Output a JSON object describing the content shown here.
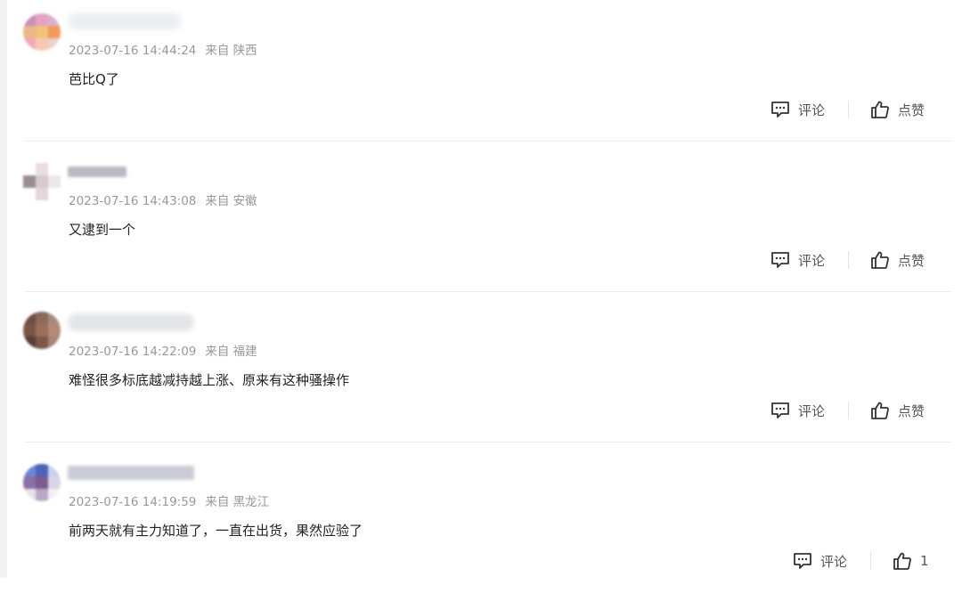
{
  "comments": [
    {
      "timestamp": "2023-07-16 14:44:24",
      "location": "来自 陕西",
      "content": "芭比Q了",
      "reply_label": "评论",
      "like_label": "点赞"
    },
    {
      "timestamp": "2023-07-16 14:43:08",
      "location": "来自 安徽",
      "content": "又逮到一个",
      "reply_label": "评论",
      "like_label": "点赞"
    },
    {
      "timestamp": "2023-07-16 14:22:09",
      "location": "来自 福建",
      "content": "难怪很多标底越减持越上涨、原来有这种骚操作",
      "reply_label": "评论",
      "like_label": "点赞"
    },
    {
      "timestamp": "2023-07-16 14:19:59",
      "location": "来自 黑龙江",
      "content": "前两天就有主力知道了，一直在出货，果然应验了",
      "reply_label": "评论",
      "like_label": "1"
    }
  ],
  "icons": {
    "reply": "comment-bubble-icon",
    "like": "thumbs-up-icon"
  },
  "colors": {
    "meta_text": "#999999",
    "content_text": "#222222",
    "action_text": "#555555",
    "divider": "#eeeeee"
  }
}
